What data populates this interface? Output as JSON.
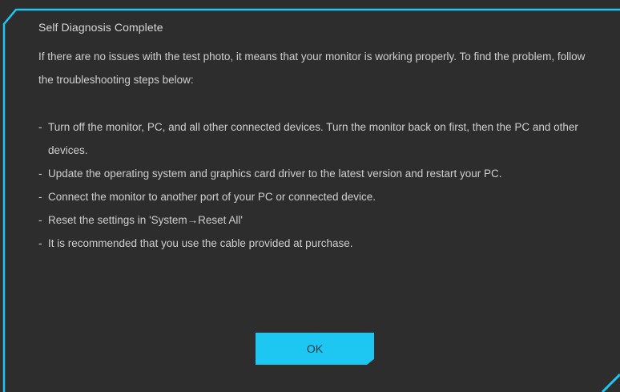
{
  "dialog": {
    "title": "Self Diagnosis Complete",
    "message": "If there are no issues with the test photo, it means that your monitor is working properly. To find the problem, follow the troubleshooting steps below:",
    "steps": [
      "Turn off the monitor, PC, and all other connected devices. Turn the monitor back on first, then the PC and other devices.",
      "Update the operating system and graphics card driver to the latest version and restart your PC.",
      "Connect the monitor to another port of your PC or connected device.",
      "Reset the settings in 'System→Reset All'",
      "It is recommended that you use the cable provided at purchase."
    ],
    "step_bullet": "-",
    "ok_label": "OK"
  },
  "colors": {
    "background": "#2d2d2d",
    "accent": "#1ec6f2",
    "text": "#cfcfcf"
  }
}
